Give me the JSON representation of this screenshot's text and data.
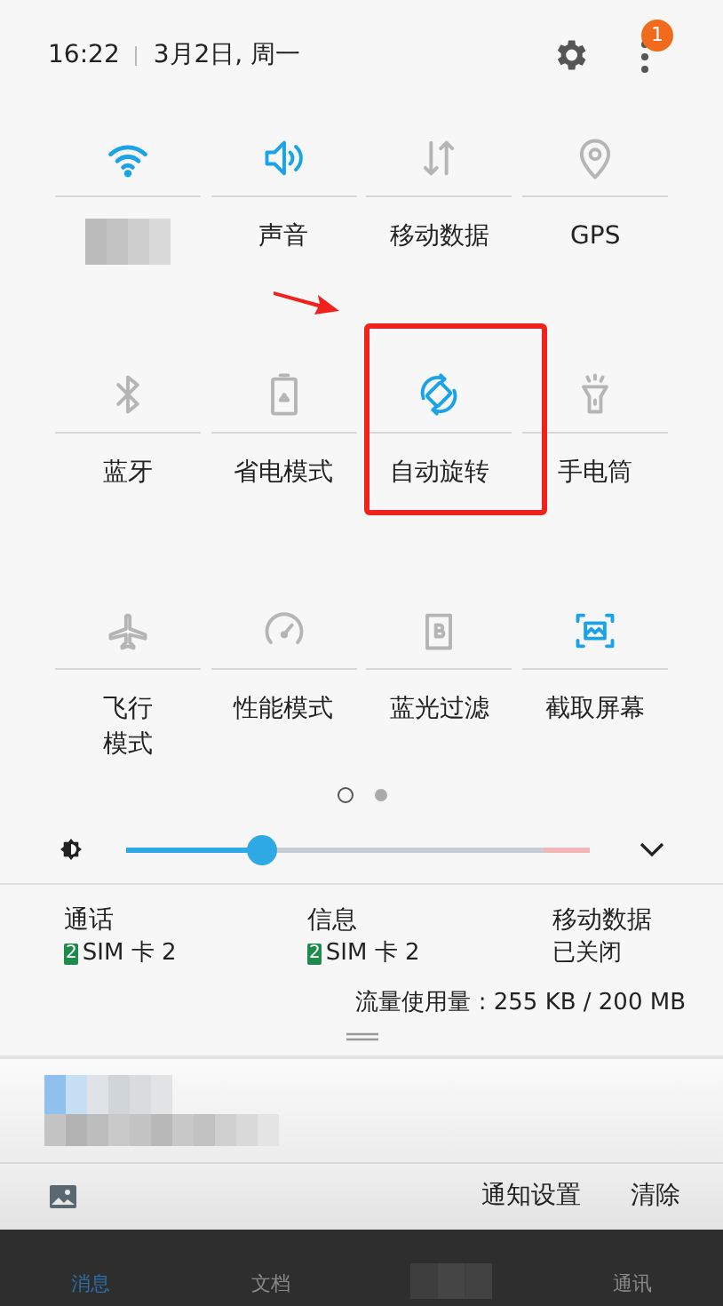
{
  "status": {
    "time": "16:22",
    "date": "3月2日, 周一",
    "notification_count": "1"
  },
  "tiles": [
    {
      "kind": "wifi",
      "active": true
    },
    {
      "kind": "sound",
      "active": true,
      "label": "声音"
    },
    {
      "kind": "data",
      "active": false,
      "label": "移动数据"
    },
    {
      "kind": "location",
      "active": false,
      "label": "GPS"
    },
    {
      "kind": "bluetooth",
      "active": false,
      "label": "蓝牙"
    },
    {
      "kind": "battery",
      "active": false,
      "label": "省电模式"
    },
    {
      "kind": "rotate",
      "active": true,
      "label": "自动旋转",
      "highlighted": true
    },
    {
      "kind": "flashlight",
      "active": false,
      "label": "手电筒"
    },
    {
      "kind": "airplane",
      "active": false,
      "label": "飞行模式"
    },
    {
      "kind": "gauge",
      "active": false,
      "label": "性能模式"
    },
    {
      "kind": "bluelight",
      "active": false,
      "label": "蓝光过滤"
    },
    {
      "kind": "screenshot",
      "active": true,
      "label": "截取屏幕"
    }
  ],
  "pages": [
    {
      "selected": true
    },
    {
      "selected": false
    }
  ],
  "brightness": {
    "level": 0.29
  },
  "sim_info": [
    {
      "title": "通话",
      "sim_badge": "2",
      "value": "SIM 卡 2"
    },
    {
      "title": "信息",
      "sim_badge": "2",
      "value": "SIM 卡 2"
    },
    {
      "title": "移动数据",
      "value": "已关闭"
    }
  ],
  "data_usage": "流量使用量 : 255 KB / 200 MB",
  "notification": {
    "kind": "blurred"
  },
  "footer": {
    "settings": "通知设置",
    "clear": "清除"
  },
  "app_tabs": [
    {
      "label": "消息",
      "selected": true
    },
    {
      "label": "文档",
      "selected": false
    },
    {
      "kind": "blurred"
    },
    {
      "label": "通讯",
      "selected": false
    }
  ]
}
